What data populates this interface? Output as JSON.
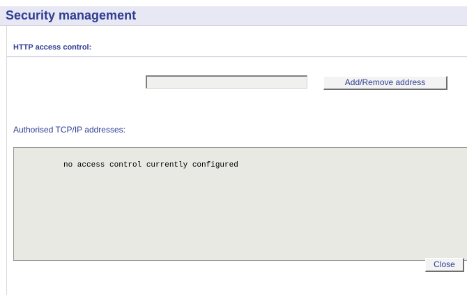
{
  "header": {
    "title": "Security management"
  },
  "section": {
    "label": "HTTP access control:"
  },
  "address_input": {
    "value": "",
    "placeholder": ""
  },
  "buttons": {
    "add_remove": "Add/Remove address",
    "close": "Close"
  },
  "authorised": {
    "label": "Authorised TCP/IP addresses:",
    "content": "no access control currently configured"
  },
  "colors": {
    "accent": "#2e3d93",
    "header_bg": "#e8e8f4",
    "panel_bg": "#e9e9e4"
  }
}
